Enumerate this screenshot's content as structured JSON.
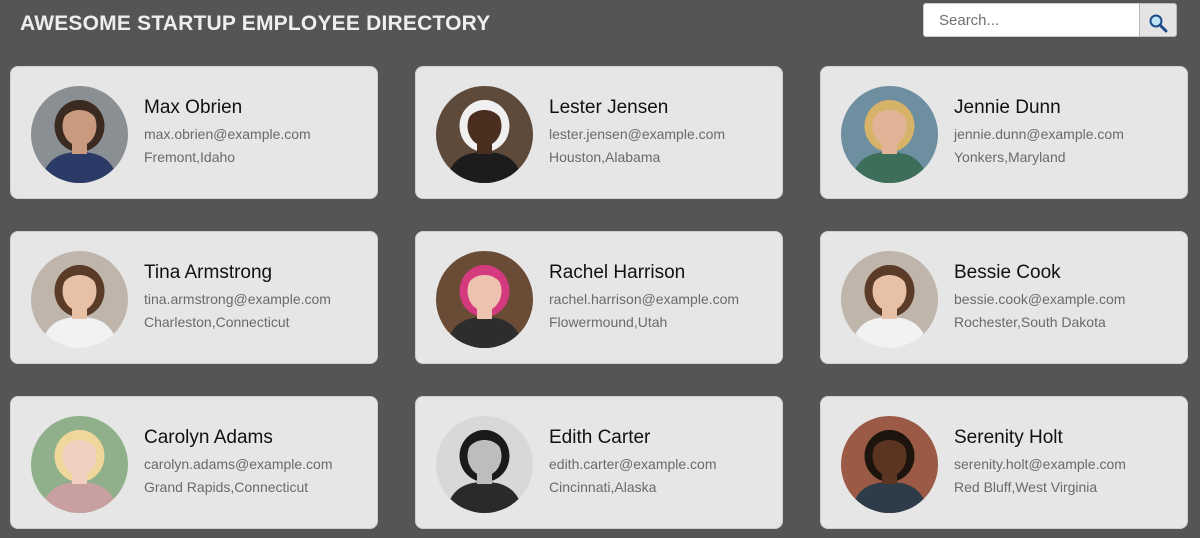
{
  "header": {
    "title": "AWESOME STARTUP EMPLOYEE DIRECTORY",
    "search": {
      "placeholder": "Search...",
      "value": "",
      "button_icon": "magnifying-glass-icon"
    }
  },
  "employees": [
    {
      "name": "Max Obrien",
      "email": "max.obrien@example.com",
      "location": "Fremont,Idaho",
      "avatar": {
        "bg": "#8a8f93",
        "skin": "#c99a7e",
        "hair": "#3b2a20",
        "shirt": "#2b3a66"
      }
    },
    {
      "name": "Lester Jensen",
      "email": "lester.jensen@example.com",
      "location": "Houston,Alabama",
      "avatar": {
        "bg": "#5e4a3b",
        "skin": "#4a2e1f",
        "hair": "#f0f0f0",
        "shirt": "#1c1c1c"
      }
    },
    {
      "name": "Jennie Dunn",
      "email": "jennie.dunn@example.com",
      "location": "Yonkers,Maryland",
      "avatar": {
        "bg": "#6d8fa0",
        "skin": "#e2b497",
        "hair": "#d7b36a",
        "shirt": "#3c6e5a"
      }
    },
    {
      "name": "Tina Armstrong",
      "email": "tina.armstrong@example.com",
      "location": "Charleston,Connecticut",
      "avatar": {
        "bg": "#bfb5ab",
        "skin": "#e8c0a6",
        "hair": "#5a3b27",
        "shirt": "#f2f2f2"
      }
    },
    {
      "name": "Rachel Harrison",
      "email": "rachel.harrison@example.com",
      "location": "Flowermound,Utah",
      "avatar": {
        "bg": "#6a4b36",
        "skin": "#edc2ae",
        "hair": "#d43a7d",
        "shirt": "#2d2d2d"
      }
    },
    {
      "name": "Bessie Cook",
      "email": "bessie.cook@example.com",
      "location": "Rochester,South Dakota",
      "avatar": {
        "bg": "#bfb5ab",
        "skin": "#e8c0a6",
        "hair": "#5a3b27",
        "shirt": "#f2f2f2"
      }
    },
    {
      "name": "Carolyn Adams",
      "email": "carolyn.adams@example.com",
      "location": "Grand Rapids,Connecticut",
      "avatar": {
        "bg": "#8fb08a",
        "skin": "#f1cfc0",
        "hair": "#efd79c",
        "shirt": "#c9a0a0"
      }
    },
    {
      "name": "Edith Carter",
      "email": "edith.carter@example.com",
      "location": "Cincinnati,Alaska",
      "avatar": {
        "bg": "#d8d8d8",
        "skin": "#bdbdbd",
        "hair": "#1a1a1a",
        "shirt": "#2a2a2a"
      }
    },
    {
      "name": "Serenity Holt",
      "email": "serenity.holt@example.com",
      "location": "Red Bluff,West Virginia",
      "avatar": {
        "bg": "#9a5a45",
        "skin": "#5c3522",
        "hair": "#1e140e",
        "shirt": "#2e3c4a"
      }
    }
  ]
}
